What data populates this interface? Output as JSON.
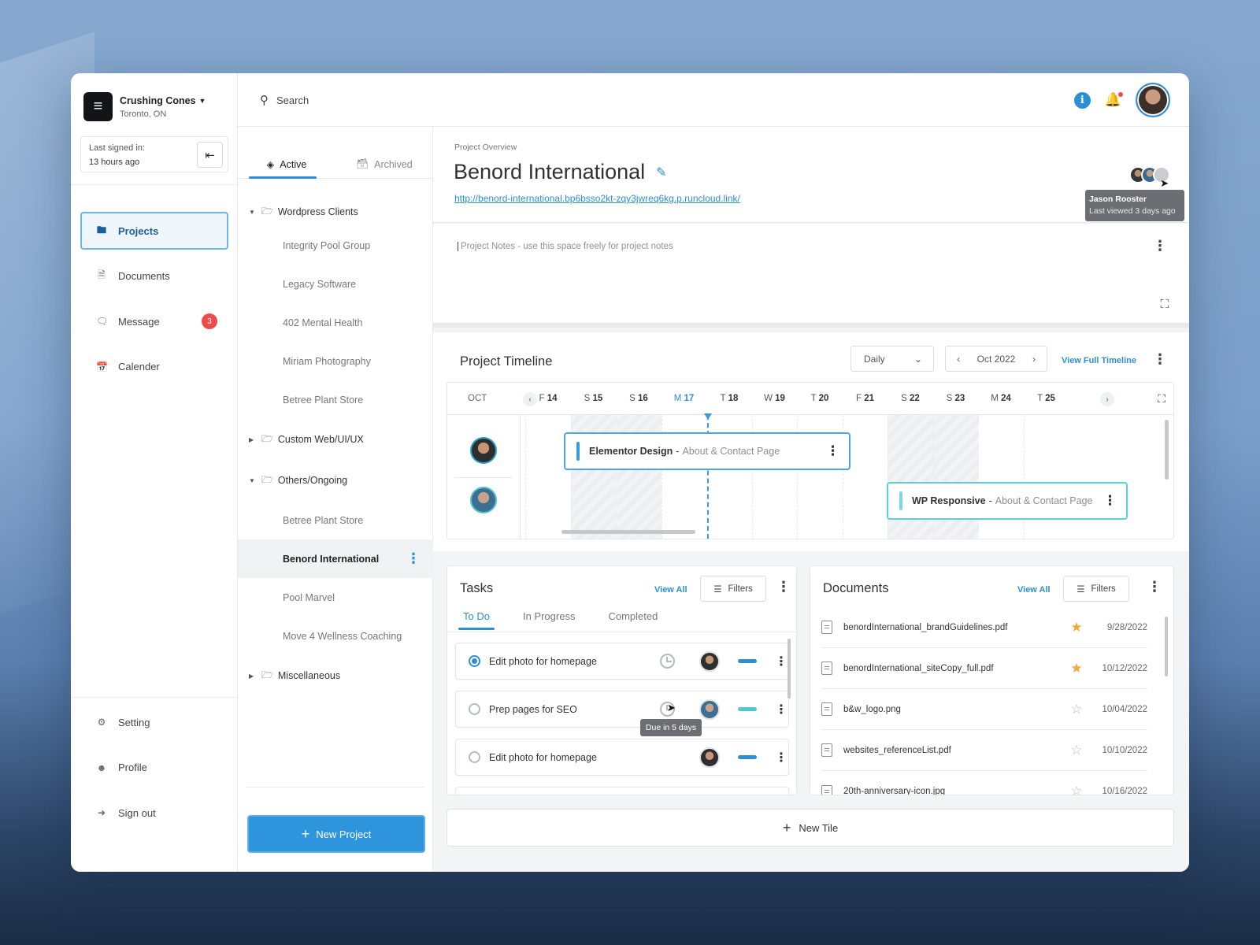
{
  "brand": {
    "name": "Crushing Cones",
    "location": "Toronto, ON",
    "logo": "logo-icon"
  },
  "session": {
    "label": "Last signed in:",
    "value": "13 hours ago"
  },
  "nav": {
    "items": [
      {
        "label": "Projects",
        "icon": "folder-icon",
        "active": true
      },
      {
        "label": "Documents",
        "icon": "document-icon"
      },
      {
        "label": "Message",
        "icon": "message-icon",
        "badge": "3"
      },
      {
        "label": "Calender",
        "icon": "calendar-icon"
      }
    ],
    "bottom": [
      {
        "label": "Setting",
        "icon": "gear-icon"
      },
      {
        "label": "Profile",
        "icon": "user-icon"
      },
      {
        "label": "Sign out",
        "icon": "sign-out-icon"
      }
    ]
  },
  "search": {
    "placeholder": "Search"
  },
  "project_tabs": {
    "active": "Active",
    "archived": "Archived"
  },
  "tree": {
    "groups": [
      {
        "label": "Wordpress Clients",
        "expanded": true,
        "items": [
          "Integrity Pool Group",
          "Legacy Software",
          "402 Mental Health",
          "Miriam Photography",
          "Betree Plant Store"
        ]
      },
      {
        "label": "Custom Web/UI/UX",
        "expanded": false,
        "items": []
      },
      {
        "label": "Others/Ongoing",
        "expanded": true,
        "items": [
          "Betree Plant Store",
          "Benord International",
          "Pool Marvel",
          "Move 4 Wellness Coaching"
        ]
      },
      {
        "label": "Miscellaneous",
        "expanded": false,
        "items": []
      }
    ],
    "selected": "Benord International"
  },
  "new_project": "New Project",
  "overview": {
    "label": "Project Overview",
    "title": "Benord International",
    "link": "http://benord-international.bp6bsso2kt-zqy3jwreq6kg.p.runcloud.link/",
    "viewer_tooltip": {
      "name": "Jason Rooster",
      "status": "Last viewed 3 days ago"
    }
  },
  "notes": {
    "placeholder": "Project Notes - use this space freely for project notes"
  },
  "timeline": {
    "title": "Project Timeline",
    "view_mode": "Daily",
    "month": "Oct 2022",
    "view_full": "View Full Timeline",
    "month_label": "OCT",
    "days": [
      {
        "d": "F",
        "n": "14"
      },
      {
        "d": "S",
        "n": "15"
      },
      {
        "d": "S",
        "n": "16"
      },
      {
        "d": "M",
        "n": "17",
        "today": true
      },
      {
        "d": "T",
        "n": "18"
      },
      {
        "d": "W",
        "n": "19"
      },
      {
        "d": "T",
        "n": "20"
      },
      {
        "d": "F",
        "n": "21"
      },
      {
        "d": "S",
        "n": "22"
      },
      {
        "d": "S",
        "n": "23"
      },
      {
        "d": "M",
        "n": "24"
      },
      {
        "d": "T",
        "n": "25"
      }
    ],
    "bars": [
      {
        "title": "Elementor Design",
        "sub": "About & Contact Page"
      },
      {
        "title": "WP Responsive",
        "sub": "About & Contact Page"
      }
    ]
  },
  "tasks": {
    "title": "Tasks",
    "view_all": "View All",
    "filters": "Filters",
    "tabs": [
      "To Do",
      "In Progress",
      "Completed"
    ],
    "rows": [
      {
        "label": "Edit photo for homepage",
        "done": true
      },
      {
        "label": "Prep pages for SEO",
        "done": false
      },
      {
        "label": "Edit photo for homepage",
        "done": false
      }
    ],
    "due_tooltip": "Due in 5 days"
  },
  "documents": {
    "title": "Documents",
    "view_all": "View All",
    "filters": "Filters",
    "rows": [
      {
        "name": "benordInternational_brandGuidelines.pdf",
        "starred": true,
        "date": "9/28/2022"
      },
      {
        "name": "benordInternational_siteCopy_full.pdf",
        "starred": true,
        "date": "10/12/2022"
      },
      {
        "name": "b&w_logo.png",
        "starred": false,
        "date": "10/04/2022"
      },
      {
        "name": "websites_referenceList.pdf",
        "starred": false,
        "date": "10/10/2022"
      },
      {
        "name": "20th-anniversary-icon.jpg",
        "starred": false,
        "date": "10/16/2022"
      }
    ]
  },
  "new_tile": "New Tile",
  "colors": {
    "accent": "#2c8fd6",
    "teal": "#4fc9cf",
    "badge": "#ef4b4b",
    "star": "#f3a83b"
  }
}
